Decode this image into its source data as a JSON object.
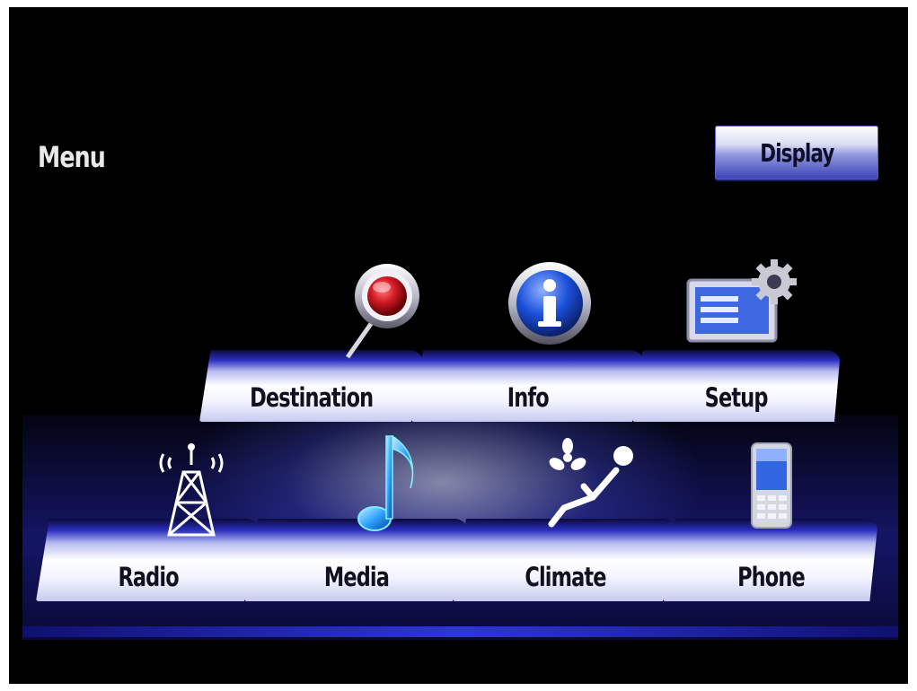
{
  "screen": {
    "title": "Menu",
    "display_label": "Display"
  },
  "menu": {
    "row1": [
      {
        "label": "Destination",
        "icon": "map-pin-icon"
      },
      {
        "label": "Info",
        "icon": "info-icon"
      },
      {
        "label": "Setup",
        "icon": "settings-screen-icon"
      }
    ],
    "row2": [
      {
        "label": "Radio",
        "icon": "radio-tower-icon"
      },
      {
        "label": "Media",
        "icon": "music-note-icon"
      },
      {
        "label": "Climate",
        "icon": "climate-seat-fan-icon"
      },
      {
        "label": "Phone",
        "icon": "mobile-phone-icon"
      }
    ]
  },
  "colors": {
    "accent_blue": "#2a2ec0",
    "tile_white": "#ffffff",
    "background": "#000000",
    "destination_red": "#c8102e"
  }
}
